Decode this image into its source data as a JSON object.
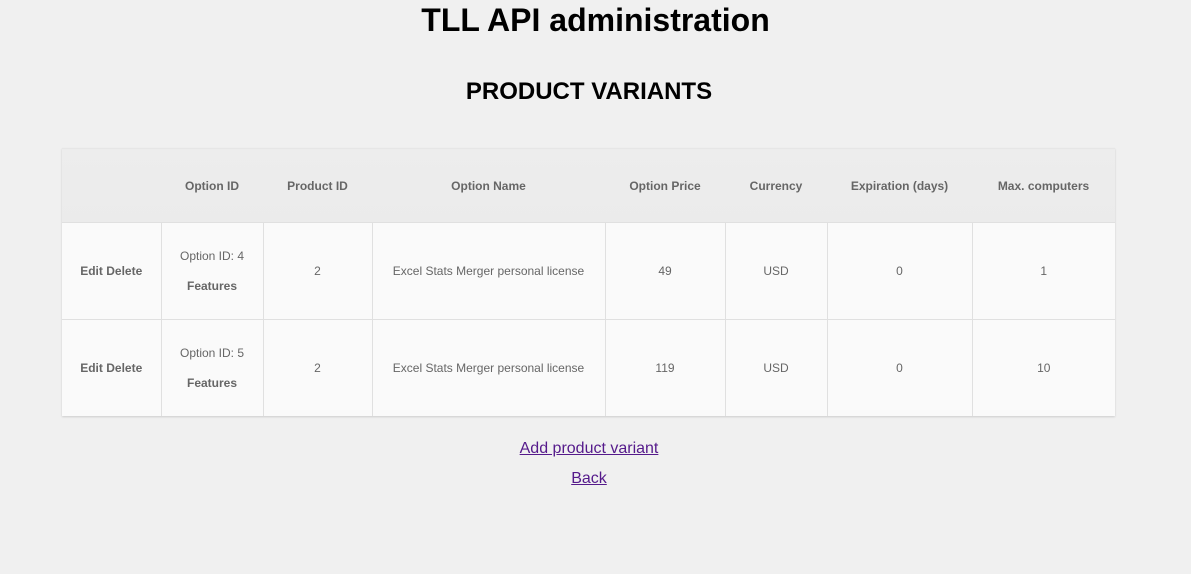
{
  "page": {
    "title": "TLL API administration",
    "section_title": "PRODUCT VARIANTS"
  },
  "table": {
    "headers": [
      "",
      "Option ID",
      "Product ID",
      "Option Name",
      "Option Price",
      "Currency",
      "Expiration (days)",
      "Max. computers"
    ],
    "rows": [
      {
        "edit_label": "Edit",
        "delete_label": "Delete",
        "option_id": "Option ID: 4",
        "features_label": "Features",
        "product_id": "2",
        "option_name": "Excel Stats Merger personal license",
        "option_price": "49",
        "currency": "USD",
        "expiration": "0",
        "max_computers": "1"
      },
      {
        "edit_label": "Edit",
        "delete_label": "Delete",
        "option_id": "Option ID: 5",
        "features_label": "Features",
        "product_id": "2",
        "option_name": "Excel Stats Merger personal license",
        "option_price": "119",
        "currency": "USD",
        "expiration": "0",
        "max_computers": "10"
      }
    ]
  },
  "links": {
    "add_variant": "Add product variant",
    "back": "Back"
  },
  "colors": {
    "background": "#f0f0f0",
    "header_bg": "#ececec",
    "link_visited": "#551a8b",
    "cell_text": "#666666"
  }
}
